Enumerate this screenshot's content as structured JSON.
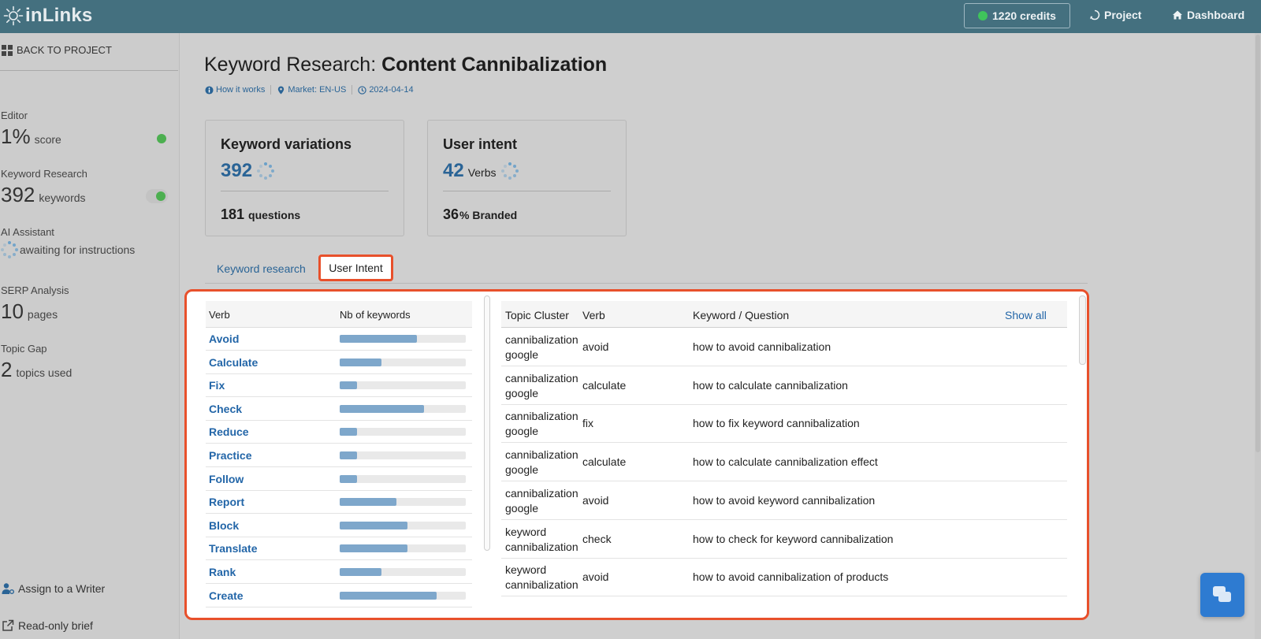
{
  "app": {
    "logo_text": "inLinks"
  },
  "topbar": {
    "credits_label": "1220 credits",
    "project_label": "Project",
    "dashboard_label": "Dashboard"
  },
  "sidebar": {
    "back_label": "BACK TO PROJECT",
    "metrics": [
      {
        "label": "Editor",
        "value": "1%",
        "unit": "score"
      },
      {
        "label": "Keyword Research",
        "value": "392",
        "unit": "keywords"
      },
      {
        "label": "AI Assistant",
        "status": "awaiting for instructions"
      },
      {
        "label": "SERP Analysis",
        "value": "10",
        "unit": "pages"
      },
      {
        "label": "Topic Gap",
        "value": "2",
        "unit": "topics used"
      }
    ],
    "assign_label": "Assign to a Writer",
    "readonly_label": "Read-only brief"
  },
  "page": {
    "title_prefix": "Keyword Research:",
    "title_main": "Content Cannibalization",
    "meta": {
      "how_it_works": "How it works",
      "market": "Market: EN-US",
      "date": "2024-04-14"
    }
  },
  "cards": {
    "keyword_variations": {
      "title": "Keyword variations",
      "count": "392",
      "footer_value": "181",
      "footer_unit": "questions"
    },
    "user_intent": {
      "title": "User intent",
      "count": "42",
      "count_unit": "Verbs",
      "footer_value": "36",
      "footer_unit": "% Branded"
    }
  },
  "tabs": [
    {
      "label": "Keyword research",
      "active": false
    },
    {
      "label": "User Intent",
      "active": true
    }
  ],
  "verb_table": {
    "headers": {
      "verb": "Verb",
      "count": "Nb of keywords"
    },
    "rows": [
      {
        "verb": "Avoid",
        "share": 0.61
      },
      {
        "verb": "Calculate",
        "share": 0.33
      },
      {
        "verb": "Fix",
        "share": 0.14
      },
      {
        "verb": "Check",
        "share": 0.67
      },
      {
        "verb": "Reduce",
        "share": 0.14
      },
      {
        "verb": "Practice",
        "share": 0.14
      },
      {
        "verb": "Follow",
        "share": 0.14
      },
      {
        "verb": "Report",
        "share": 0.45
      },
      {
        "verb": "Block",
        "share": 0.54
      },
      {
        "verb": "Translate",
        "share": 0.54
      },
      {
        "verb": "Rank",
        "share": 0.33
      },
      {
        "verb": "Create",
        "share": 0.77
      }
    ]
  },
  "keyword_table": {
    "headers": {
      "cluster": "Topic Cluster",
      "verb": "Verb",
      "keyword": "Keyword / Question",
      "show_all": "Show all"
    },
    "rows": [
      {
        "cluster": "cannibalization google",
        "verb": "avoid",
        "keyword": "how to avoid cannibalization"
      },
      {
        "cluster": "cannibalization google",
        "verb": "calculate",
        "keyword": "how to calculate cannibalization"
      },
      {
        "cluster": "cannibalization google",
        "verb": "fix",
        "keyword": "how to fix keyword cannibalization"
      },
      {
        "cluster": "cannibalization google",
        "verb": "calculate",
        "keyword": "how to calculate cannibalization effect"
      },
      {
        "cluster": "cannibalization google",
        "verb": "avoid",
        "keyword": "how to avoid keyword cannibalization"
      },
      {
        "cluster": "keyword cannibalization",
        "verb": "check",
        "keyword": "how to check for keyword cannibalization"
      },
      {
        "cluster": "keyword cannibalization",
        "verb": "avoid",
        "keyword": "how to avoid cannibalization of products"
      }
    ]
  },
  "colors": {
    "topbar": "#44707f",
    "accent_blue": "#2366a8",
    "highlight": "#e8502b",
    "bar_fill": "#7ea7cb",
    "status_green": "#4caf50"
  },
  "icons": [
    "logo-sun-icon",
    "credit-dot-icon",
    "project-icon",
    "home-icon",
    "grid-icon",
    "spinner-icon",
    "user-gear-icon",
    "external-link-icon",
    "info-icon",
    "map-pin-icon",
    "clock-icon",
    "chat-icon"
  ]
}
